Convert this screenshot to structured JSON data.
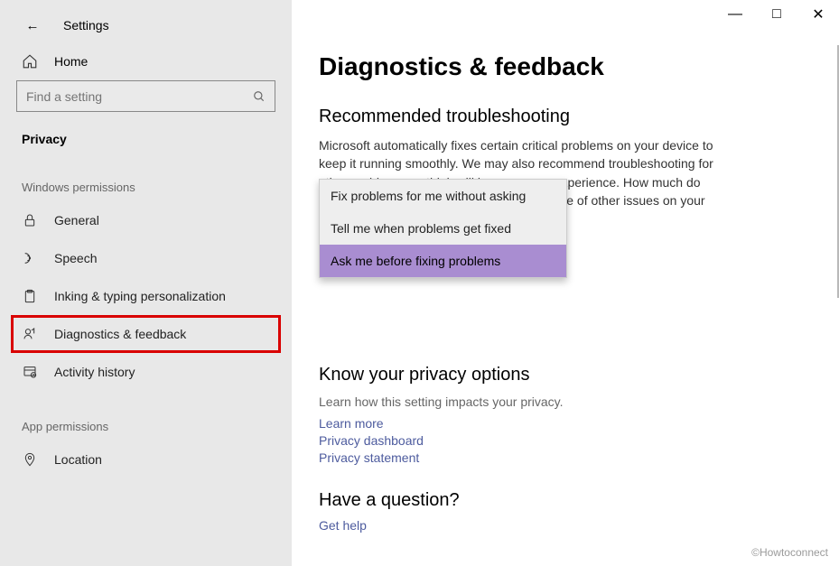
{
  "header": {
    "back_glyph": "←",
    "title": "Settings"
  },
  "window_controls": {
    "minimize": "—",
    "maximize": "□",
    "close": "✕"
  },
  "sidebar": {
    "home_label": "Home",
    "search": {
      "placeholder": "Find a setting"
    },
    "current_section": "Privacy",
    "subsection_windows": "Windows permissions",
    "subsection_app": "App permissions",
    "items_windows": [
      {
        "label": "General"
      },
      {
        "label": "Speech"
      },
      {
        "label": "Inking & typing personalization"
      },
      {
        "label": "Diagnostics & feedback"
      },
      {
        "label": "Activity history"
      }
    ],
    "items_app": [
      {
        "label": "Location"
      }
    ]
  },
  "main": {
    "title": "Diagnostics & feedback",
    "section1": {
      "heading": "Recommended troubleshooting",
      "body": "Microsoft automatically fixes certain critical problems on your device to keep it running smoothly. We may also recommend troubleshooting for other problems we think will improve your experience. How much do you want Microsoft's help when we are aware of other issues on your device that troubleshooting might fix?"
    },
    "dropdown": {
      "options": [
        {
          "label": "Fix problems for me without asking"
        },
        {
          "label": "Tell me when problems get fixed"
        },
        {
          "label": "Ask me before fixing problems"
        }
      ]
    },
    "section2": {
      "heading": "Know your privacy options",
      "desc": "Learn how this setting impacts your privacy.",
      "links": [
        {
          "label": "Learn more"
        },
        {
          "label": "Privacy dashboard"
        },
        {
          "label": "Privacy statement"
        }
      ]
    },
    "section3": {
      "heading": "Have a question?",
      "link": "Get help"
    }
  },
  "watermark": "©Howtoconnect"
}
